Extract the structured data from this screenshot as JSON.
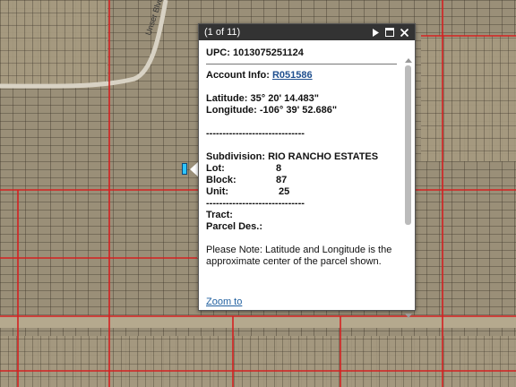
{
  "popup": {
    "count_label": "(1 of 11)",
    "upc_label": "UPC:",
    "upc_value": "1013075251124",
    "account_label": "Account Info:",
    "account_value": "R051586",
    "latitude_label": "Latitude:",
    "latitude_value": "35° 20' 14.483\"",
    "longitude_label": "Longitude:",
    "longitude_value": "-106° 39' 52.686\"",
    "separator": "------------------------------",
    "subdivision_label": "Subdivision:",
    "subdivision_value": "RIO RANCHO ESTATES",
    "lot_label": "Lot:",
    "lot_value": "8",
    "block_label": "Block:",
    "block_value": "87",
    "unit_label": "Unit:",
    "unit_value": "25",
    "tract_label": "Tract:",
    "parcel_label": "Parcel Des.:",
    "note": "Please Note: Latitude and Longitude is the approximate center of the parcel shown.",
    "zoom_label": "Zoom to"
  },
  "map": {
    "road_label": "Unser Blvd",
    "colors": {
      "ground": "#9a8f78",
      "parcel_line": "#3b3428",
      "boundary": "#d42020",
      "road": "#d8d2c4"
    }
  }
}
